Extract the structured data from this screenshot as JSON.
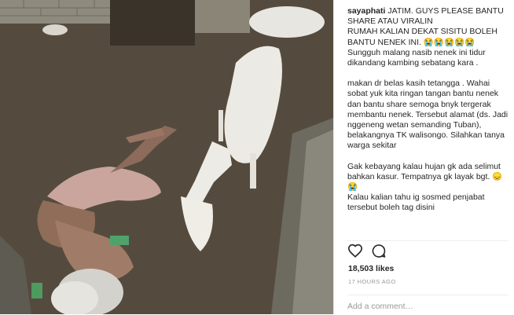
{
  "post": {
    "username": "sayaphati",
    "caption_lines": [
      "JATIM. GUYS PLEASE BANTU SHARE ATAU VIRALIN",
      "RUMAH KALIAN DEKAT SISITU BOLEH BANTU NENEK INI. 😭😭😭😭😭",
      "Sungguh malang nasib nenek ini tidur dikandang kambing sebatang kara .",
      "",
      "makan dr belas kasih tetangga . Wahai sobat yuk kita ringan tangan bantu nenek dan bantu share semoga bnyk tergerak membantu nenek. Tersebut alamat (ds. Jadi nggeneng wetan semanding Tuban), belakangnya TK walisongo. Silahkan tanya warga sekitar",
      "",
      "Gak kebayang kalau hujan gk ada selimut bahkan kasur. Tempatnya gk layak bgt. 😞😭",
      "Kalau kalian tahu ig sosmed penjabat tersebut boleh tag disini"
    ]
  },
  "actions": {
    "like_icon": "heart-icon",
    "comment_icon": "comment-bubble-icon"
  },
  "likes_text": "18,503 likes",
  "timestamp": "17 HOURS AGO",
  "comment": {
    "placeholder": "Add a comment…"
  },
  "colors": {
    "text": "#262626",
    "muted": "#999999",
    "border": "#efefef"
  }
}
